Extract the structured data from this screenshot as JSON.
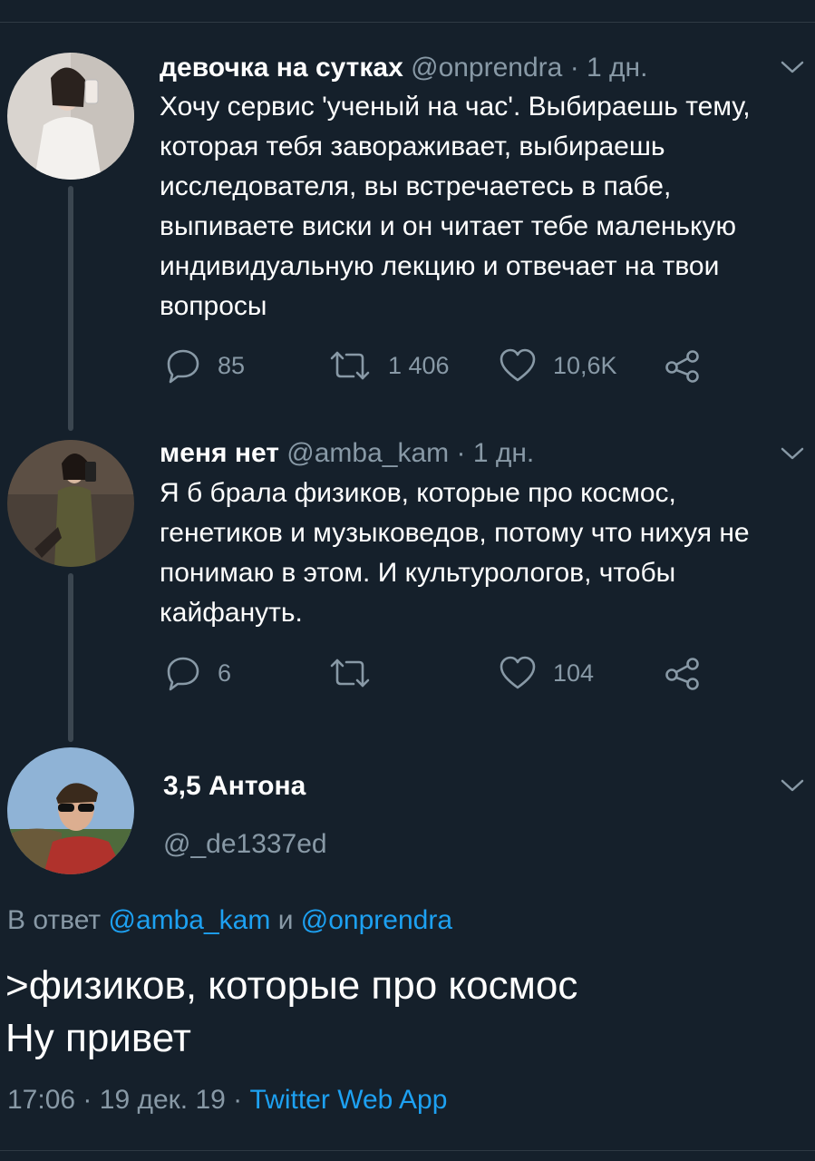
{
  "tweets": [
    {
      "name": "девочка на сутках",
      "handle": "@onprendra",
      "separator": "·",
      "time": "1 дн.",
      "text": "Хочу сервис 'ученый на час'. Выбираешь тему, которая тебя завораживает, выбираешь исследователя, вы встречаетесь в пабе, выпиваете виски и он читает тебе маленькую индивидуальную лекцию и отвечает на твои вопросы",
      "replies": "85",
      "retweets": "1 406",
      "likes": "10,6K"
    },
    {
      "name": "меня нет",
      "handle": "@amba_kam",
      "separator": "·",
      "time": "1 дн.",
      "text": "Я б брала физиков, которые про космос, генетиков и музыковедов, потому что нихуя не понимаю в этом. И культурологов, чтобы кайфануть.",
      "replies": "6",
      "retweets": "",
      "likes": "104"
    }
  ],
  "main_tweet": {
    "name": "3,5 Антона",
    "handle": "@_de1337ed",
    "reply_prefix": "В ответ",
    "reply_user1": "@amba_kam",
    "reply_conj": "и",
    "reply_user2": "@onprendra",
    "line1": ">физиков, которые про космос",
    "line2": "Ну привет",
    "time": "17:06",
    "dot": "·",
    "date": "19 дек. 19",
    "source": "Twitter Web App"
  },
  "colors": {
    "background": "#15202b",
    "text": "#ffffff",
    "secondary": "#8899a6",
    "link": "#1da1f2",
    "thread_line": "#3b4650"
  },
  "icons": [
    "reply-icon",
    "retweet-icon",
    "like-icon",
    "share-icon",
    "chevron-down-icon"
  ]
}
